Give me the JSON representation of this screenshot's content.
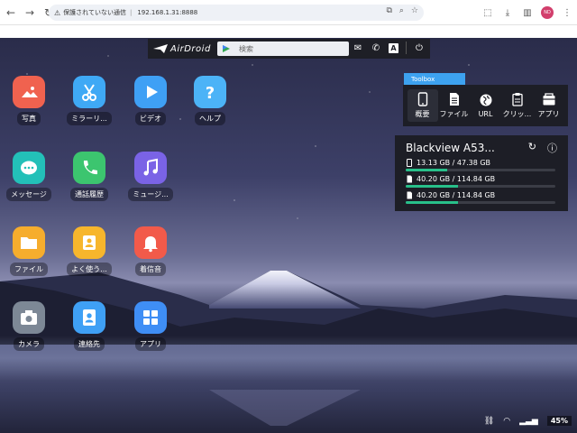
{
  "browser": {
    "security_label": "保護されていない通信",
    "url": "192.168.1.31:8888",
    "profile_initials": "ND"
  },
  "topbar": {
    "logo_text": "AirDroid",
    "search_placeholder": "検索",
    "keyboard_label": "A"
  },
  "apps": [
    {
      "label": "写真",
      "icon": "photos-icon",
      "color": "#f0624f"
    },
    {
      "label": "ミラーリ...",
      "icon": "scissors-icon",
      "color": "#3fa9f5"
    },
    {
      "label": "ビデオ",
      "icon": "video-play-icon",
      "color": "#3fa0f5"
    },
    {
      "label": "ヘルプ",
      "icon": "help-icon",
      "color": "#4cb3f7"
    },
    {
      "label": "メッセージ",
      "icon": "message-icon",
      "color": "#23c0b8"
    },
    {
      "label": "通話履歴",
      "icon": "phone-icon",
      "color": "#3cc56f"
    },
    {
      "label": "ミュージ...",
      "icon": "music-icon",
      "color": "#7a63e6"
    },
    {
      "label": "ファイル",
      "icon": "folder-icon",
      "color": "#f6ad2d"
    },
    {
      "label": "よく使う...",
      "icon": "frequent-contacts-icon",
      "color": "#f7b62c"
    },
    {
      "label": "着信音",
      "icon": "bell-icon",
      "color": "#f25a4a"
    },
    {
      "label": "カメラ",
      "icon": "camera-icon",
      "color": "#7d8896"
    },
    {
      "label": "連絡先",
      "icon": "contacts-icon",
      "color": "#3fa0f5"
    },
    {
      "label": "アプリ",
      "icon": "apps-grid-icon",
      "color": "#3f8ef5"
    }
  ],
  "toolbox": {
    "tab_label": "Toolbox",
    "tools": [
      {
        "label": "概要",
        "icon": "phone-overview-icon"
      },
      {
        "label": "ファイル",
        "icon": "file-icon"
      },
      {
        "label": "URL",
        "icon": "globe-icon"
      },
      {
        "label": "クリッ...",
        "icon": "clipboard-icon"
      },
      {
        "label": "アプリ",
        "icon": "app-box-icon"
      }
    ]
  },
  "device": {
    "name": "Blackview A53...",
    "storage": [
      {
        "text": "13.13 GB / 47.38 GB",
        "fraction": 0.277,
        "icon": "phone-storage-icon"
      },
      {
        "text": "40.20 GB / 114.84 GB",
        "fraction": 0.35,
        "icon": "sd-card-icon"
      },
      {
        "text": "40.20 GB / 114.84 GB",
        "fraction": 0.35,
        "icon": "sd-card-icon"
      }
    ]
  },
  "status": {
    "battery": "45%"
  }
}
